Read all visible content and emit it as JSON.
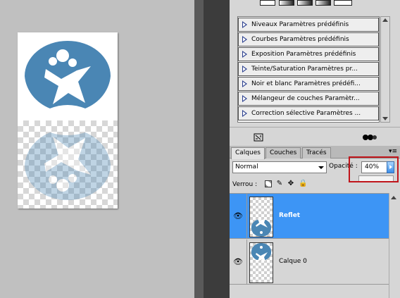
{
  "adjustments": {
    "items": [
      {
        "label": "Niveaux Paramètres prédéfinis"
      },
      {
        "label": "Courbes Paramètres prédéfinis"
      },
      {
        "label": "Exposition Paramètres prédéfinis"
      },
      {
        "label": "Teinte/Saturation Paramètres pr..."
      },
      {
        "label": "Noir et blanc Paramètres prédéfi..."
      },
      {
        "label": "Mélangeur de couches Paramètr..."
      },
      {
        "label": "Correction sélective Paramètres ..."
      }
    ]
  },
  "layers_panel": {
    "tabs": [
      {
        "label": "Calques",
        "active": true
      },
      {
        "label": "Couches",
        "active": false
      },
      {
        "label": "Tracés",
        "active": false
      }
    ],
    "blend_mode": "Normal",
    "opacity_label": "Opacité :",
    "opacity_value": "40%",
    "lock_label": "Verrou :",
    "layers": [
      {
        "name": "Reflet",
        "selected": true
      },
      {
        "name": "Calque 0",
        "selected": false
      }
    ]
  },
  "colors": {
    "logo_blue": "#4a86b4",
    "selection_blue": "#3d95f5",
    "highlight_red": "#c0151b"
  },
  "icons": [
    "visibility-eye-icon",
    "lock-transparency-icon",
    "lock-brush-icon",
    "lock-move-icon",
    "lock-all-icon",
    "panel-menu-icon",
    "clip-icon",
    "eye-glasses-icon"
  ]
}
